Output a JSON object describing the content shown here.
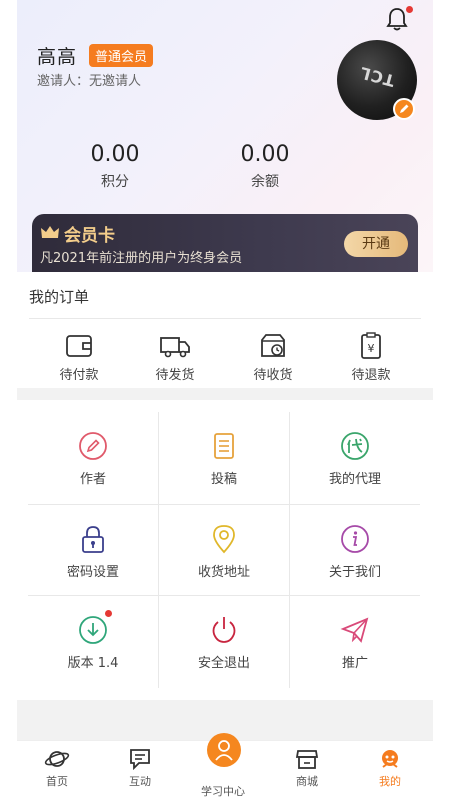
{
  "profile": {
    "name": "高高",
    "member_level": "普通会员",
    "inviter": "邀请人：无邀请人",
    "avatar_icon": "tcl-logo-avatar",
    "avatar_text": "TCL"
  },
  "stats": [
    {
      "value": "0.00",
      "label": "积分"
    },
    {
      "value": "0.00",
      "label": "余额"
    }
  ],
  "vip_card": {
    "title": "会员卡",
    "description": "凡2021年前注册的用户为终身会员",
    "button": "开通"
  },
  "orders": {
    "title": "我的订单",
    "items": [
      {
        "label": "待付款",
        "icon": "wallet-icon"
      },
      {
        "label": "待发货",
        "icon": "truck-icon"
      },
      {
        "label": "待收货",
        "icon": "package-clock-icon"
      },
      {
        "label": "待退款",
        "icon": "refund-icon"
      }
    ]
  },
  "grid": [
    {
      "label": "作者",
      "icon": "pencil-icon",
      "color": "#e05a6b"
    },
    {
      "label": "投稿",
      "icon": "document-icon",
      "color": "#e6a23c"
    },
    {
      "label": "我的代理",
      "icon": "agent-icon",
      "color": "#3aa56b"
    },
    {
      "label": "密码设置",
      "icon": "lock-icon",
      "color": "#3b3f8c"
    },
    {
      "label": "收货地址",
      "icon": "location-icon",
      "color": "#e0b72a"
    },
    {
      "label": "关于我们",
      "icon": "info-icon",
      "color": "#a64aa8"
    },
    {
      "label": "版本 1.4",
      "icon": "download-icon",
      "color": "#2fa67a"
    },
    {
      "label": "安全退出",
      "icon": "power-icon",
      "color": "#c8253f"
    },
    {
      "label": "推广",
      "icon": "paper-plane-icon",
      "color": "#d94a79"
    }
  ],
  "tabbar": [
    {
      "label": "首页",
      "icon": "planet-icon"
    },
    {
      "label": "互动",
      "icon": "chat-icon"
    },
    {
      "label": "学习中心",
      "icon": "study-center-icon"
    },
    {
      "label": "商城",
      "icon": "store-icon"
    },
    {
      "label": "我的",
      "icon": "profile-icon"
    }
  ],
  "colors": {
    "accent": "#f57c1f",
    "vip_gold": "#f3cd8b",
    "vip_dark": "#2f2b3a"
  }
}
